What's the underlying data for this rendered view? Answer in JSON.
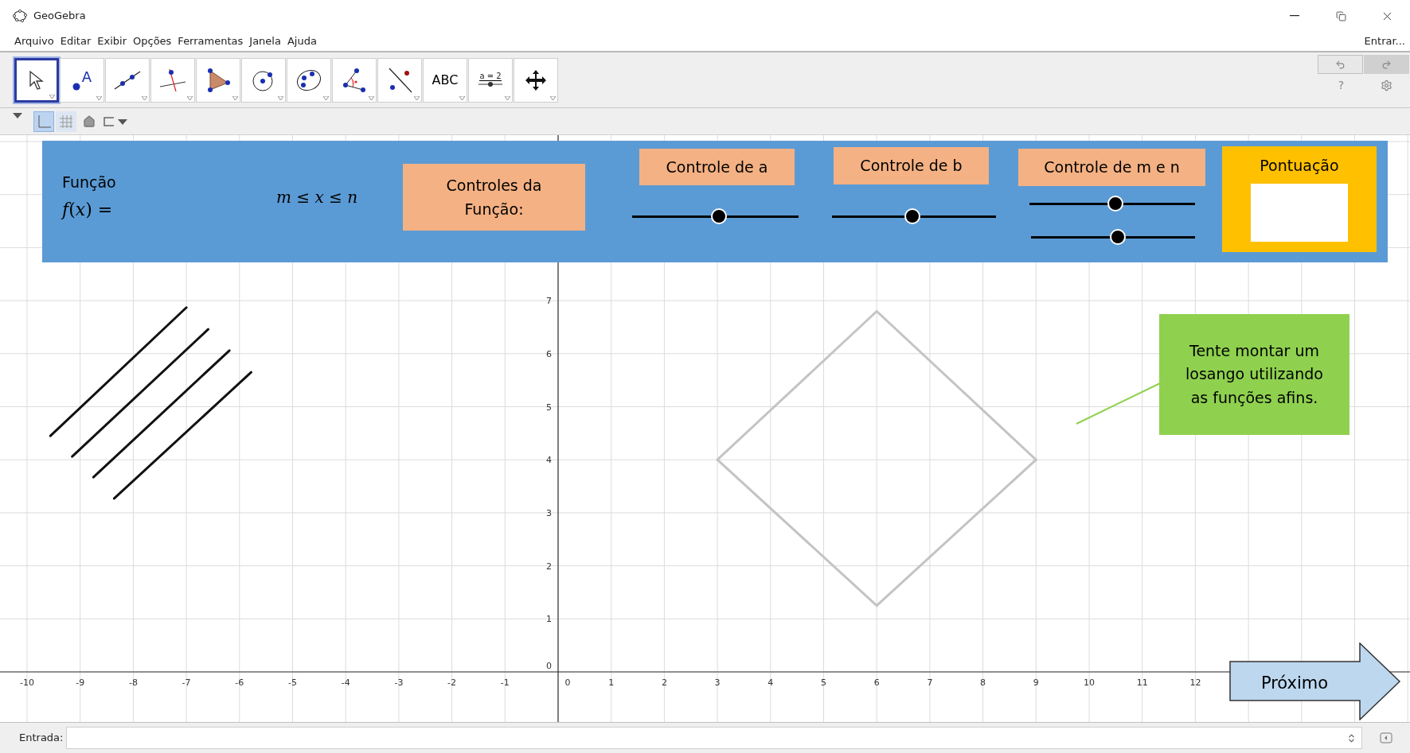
{
  "window": {
    "title": "GeoGebra"
  },
  "menu": [
    "Arquivo",
    "Editar",
    "Exibir",
    "Opções",
    "Ferramentas",
    "Janela",
    "Ajuda"
  ],
  "login": "Entrar...",
  "toolbar": {
    "tools": [
      {
        "kind": "move",
        "selected": true
      },
      {
        "kind": "point",
        "selected": false,
        "label": "A"
      },
      {
        "kind": "line",
        "selected": false
      },
      {
        "kind": "perpendicular",
        "selected": false
      },
      {
        "kind": "polygon",
        "selected": false
      },
      {
        "kind": "circle",
        "selected": false
      },
      {
        "kind": "conic",
        "selected": false
      },
      {
        "kind": "angle",
        "selected": false
      },
      {
        "kind": "reflect",
        "selected": false
      },
      {
        "kind": "text",
        "selected": false,
        "label": "ABC"
      },
      {
        "kind": "slider",
        "selected": false,
        "label": "a = 2"
      },
      {
        "kind": "pan",
        "selected": false
      }
    ],
    "help": "?"
  },
  "style_bar": {
    "views": [
      {
        "kind": "axes",
        "selected": true
      },
      {
        "kind": "grid",
        "selected": false
      }
    ]
  },
  "graphics": {
    "x_labels": [
      "-10",
      "-9",
      "-8",
      "-7",
      "-6",
      "-5",
      "-4",
      "-3",
      "-2",
      "-1",
      "0",
      "1",
      "2",
      "3",
      "4",
      "5",
      "6",
      "7",
      "8",
      "9",
      "10",
      "11",
      "12"
    ],
    "y_labels": [
      "7",
      "6",
      "5",
      "4",
      "3",
      "2",
      "1",
      "0"
    ],
    "panel": {
      "title": "Função",
      "formula": "*f*(*x*) =",
      "domain": "*m* ≤ *x* ≤ *n*",
      "controls_label": "Controles da Função:",
      "sliders": [
        {
          "label": "Controle de a",
          "level": 0.52
        },
        {
          "label": "Controle de b",
          "level": 0.49
        },
        {
          "label": "Controle de m e n",
          "level": 0.52
        },
        {
          "level": 0.53
        }
      ],
      "score_label": "Pontuação"
    },
    "note": "Tente montar um losango utilizando as funções afins.",
    "next_button": "Próximo"
  },
  "input_bar": {
    "label": "Entrada:"
  }
}
